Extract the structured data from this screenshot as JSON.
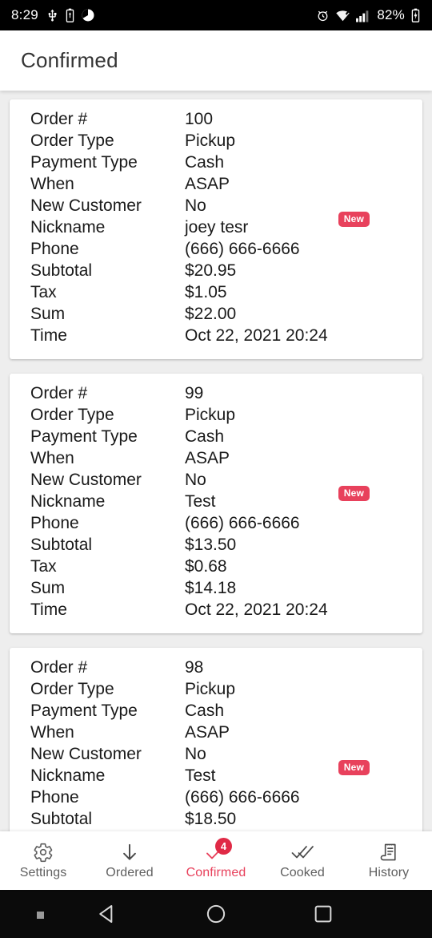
{
  "statusbar": {
    "time": "8:29",
    "battery_percent": "82%",
    "icons": [
      "usb-icon",
      "battery-usb-icon",
      "data-saver-icon",
      "alarm-icon",
      "wifi-icon",
      "cell-signal-icon",
      "battery-charging-icon"
    ]
  },
  "appbar": {
    "title": "Confirmed"
  },
  "labels": {
    "order_no": "Order #",
    "order_type": "Order Type",
    "payment_type": "Payment Type",
    "when": "When",
    "new_customer": "New Customer",
    "nickname": "Nickname",
    "phone": "Phone",
    "subtotal": "Subtotal",
    "tax": "Tax",
    "sum": "Sum",
    "time": "Time"
  },
  "badge_text": "New",
  "orders": [
    {
      "order_no": "100",
      "order_type": "Pickup",
      "payment_type": "Cash",
      "when": "ASAP",
      "new_customer": "No",
      "nickname": "joey tesr",
      "phone": "(666) 666-6666",
      "subtotal": "$20.95",
      "tax": "$1.05",
      "sum": "$22.00",
      "time": "Oct 22, 2021 20:24"
    },
    {
      "order_no": "99",
      "order_type": "Pickup",
      "payment_type": "Cash",
      "when": "ASAP",
      "new_customer": "No",
      "nickname": "Test",
      "phone": "(666) 666-6666",
      "subtotal": "$13.50",
      "tax": "$0.68",
      "sum": "$14.18",
      "time": "Oct 22, 2021 20:24"
    },
    {
      "order_no": "98",
      "order_type": "Pickup",
      "payment_type": "Cash",
      "when": "ASAP",
      "new_customer": "No",
      "nickname": "Test",
      "phone": "(666) 666-6666",
      "subtotal": "$18.50"
    }
  ],
  "tabbar": {
    "accent_color": "#e8415c",
    "inactive_color": "#5f5f5f",
    "tabs": [
      {
        "label": "Settings",
        "icon": "gear-icon",
        "active": false,
        "badge": null
      },
      {
        "label": "Ordered",
        "icon": "arrow-down-icon",
        "active": false,
        "badge": null
      },
      {
        "label": "Confirmed",
        "icon": "check-icon",
        "active": true,
        "badge": "4"
      },
      {
        "label": "Cooked",
        "icon": "double-check-icon",
        "active": false,
        "badge": null
      },
      {
        "label": "History",
        "icon": "receipt-icon",
        "active": false,
        "badge": null
      }
    ]
  },
  "navbar": {
    "buttons": [
      "hide-nav-dot",
      "back-button",
      "home-button",
      "recents-button"
    ]
  }
}
